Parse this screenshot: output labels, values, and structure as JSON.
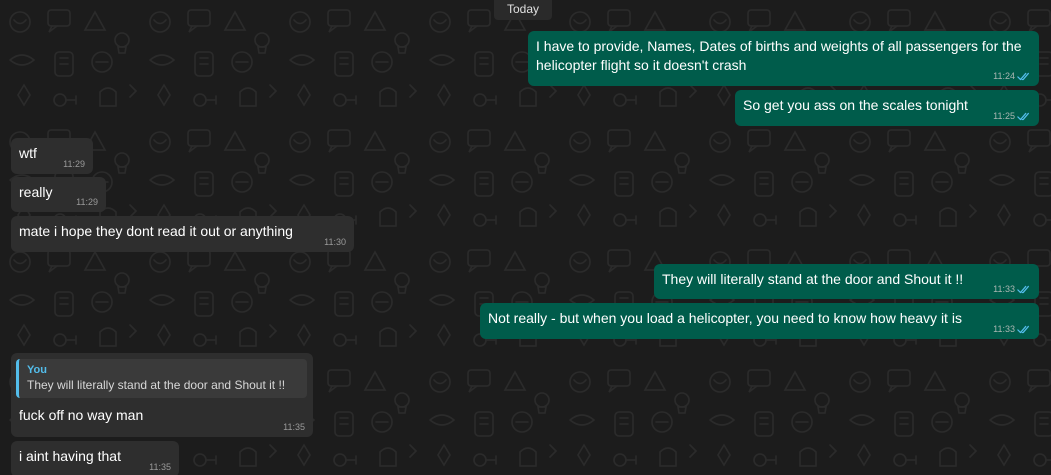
{
  "date_divider": "Today",
  "messages": [
    {
      "direction": "out",
      "text": "I have to provide, Names, Dates of births and weights of all passengers for the helicopter flight so it doesn't crash",
      "time": "11:24",
      "status": "read"
    },
    {
      "direction": "out",
      "text": "So get you ass on the scales tonight",
      "time": "11:25",
      "status": "read"
    },
    {
      "direction": "in",
      "text": "wtf",
      "time": "11:29"
    },
    {
      "direction": "in",
      "text": "really",
      "time": "11:29"
    },
    {
      "direction": "in",
      "text": "mate i hope they dont read it out or anything",
      "time": "11:30"
    },
    {
      "direction": "out",
      "text": "They will literally stand at the door and Shout it !!",
      "time": "11:33",
      "status": "read"
    },
    {
      "direction": "out",
      "text": "Not really - but when you load a helicopter, you need to know how heavy it is",
      "time": "11:33",
      "status": "read"
    },
    {
      "direction": "in",
      "quote": {
        "author": "You",
        "text": "They will literally stand at the door and Shout it !!"
      },
      "text": "fuck off no way man",
      "time": "11:35"
    },
    {
      "direction": "in",
      "text": "i aint having that",
      "time": "11:35"
    }
  ],
  "colors": {
    "outgoing_bubble": "#005c4b",
    "incoming_bubble": "#2e2e2e",
    "read_ticks": "#53bdeb",
    "quote_accent": "#53bdeb"
  },
  "icons": {
    "read_receipt": "double-check-icon"
  }
}
